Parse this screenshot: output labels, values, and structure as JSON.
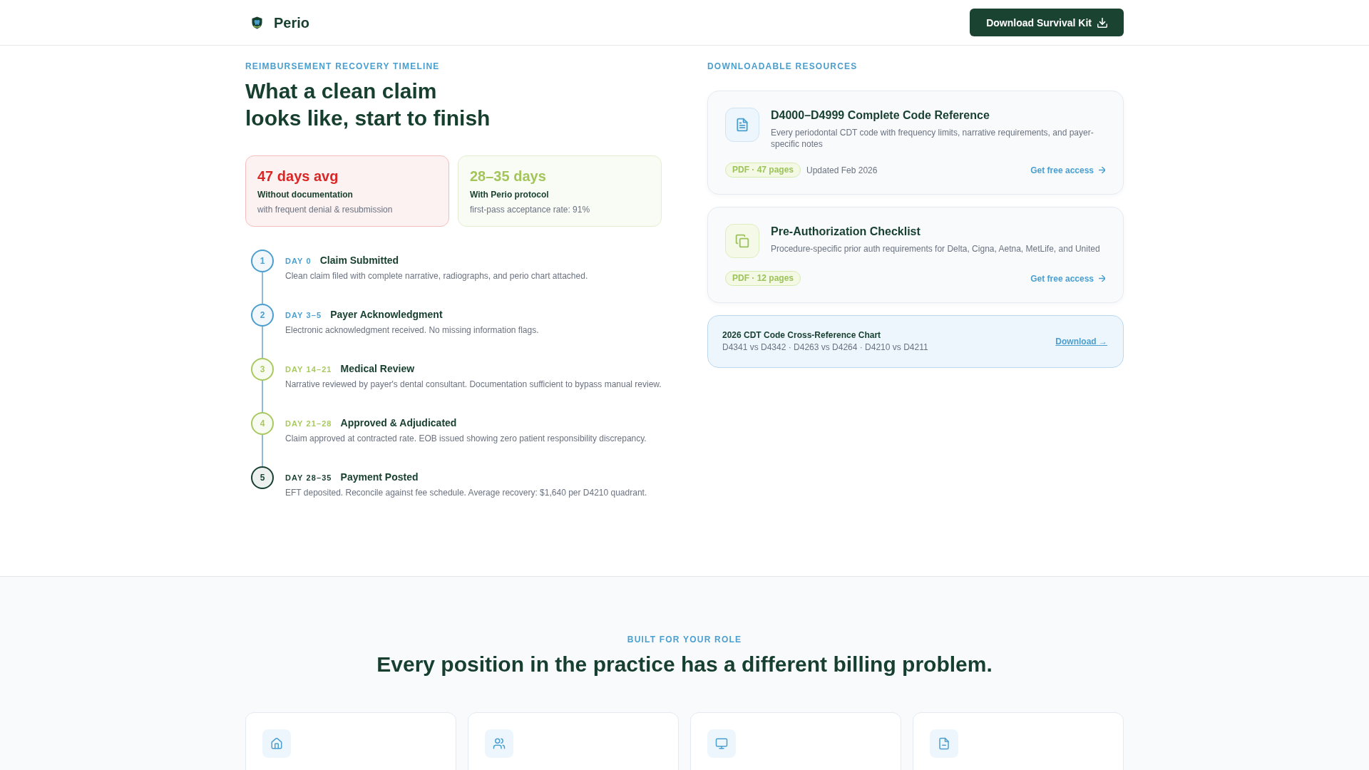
{
  "header": {
    "brand": "Perio",
    "cta": "Download Survival Kit"
  },
  "timeline": {
    "eyebrow": "REIMBURSEMENT RECOVERY TIMELINE",
    "title": "What a clean claim\nlooks like, start to finish",
    "stats": [
      {
        "value": "47 days avg",
        "label": "Without documentation",
        "note": "with frequent denial & resubmission",
        "color": "#dc2626"
      },
      {
        "value": "28–35 days",
        "label": "With Perio protocol",
        "note": "first-pass acceptance rate: 91%",
        "color": "#a3c55a"
      }
    ],
    "steps": [
      {
        "number": "1",
        "day": "DAY 0",
        "title": "Claim Submitted",
        "description": "Clean claim filed with complete narrative, radiographs, and perio chart attached.",
        "color": "#4a9fcf"
      },
      {
        "number": "2",
        "day": "DAY 3–5",
        "title": "Payer Acknowledgment",
        "description": "Electronic acknowledgment received. No missing information flags.",
        "color": "#4a9fcf"
      },
      {
        "number": "3",
        "day": "DAY 14–21",
        "title": "Medical Review",
        "description": "Narrative reviewed by payer's dental consultant. Documentation sufficient to bypass manual review.",
        "color": "#a9c95f"
      },
      {
        "number": "4",
        "day": "DAY 21–28",
        "title": "Approved & Adjudicated",
        "description": "Claim approved at contracted rate. EOB issued showing zero patient responsibility discrepancy.",
        "color": "#a9c95f"
      },
      {
        "number": "5",
        "day": "DAY 28–35",
        "title": "Payment Posted",
        "description": "EFT deposited. Reconcile against fee schedule. Average recovery: $1,640 per D4210 quadrant.",
        "color": "#173f2f"
      }
    ]
  },
  "resources": {
    "eyebrow": "DOWNLOADABLE RESOURCES",
    "items": [
      {
        "title": "D4000–D4999 Complete Code Reference",
        "description": "Every periodontal CDT code with frequency limits, narrative requirements, and payer-specific notes",
        "badge": "PDF · 47 pages",
        "updated": "Updated Feb 2026",
        "link": "Get free access"
      },
      {
        "title": "Pre-Authorization Checklist",
        "description": "Procedure-specific prior auth requirements for Delta, Cigna, Aetna, MetLife, and United",
        "badge": "PDF · 12 pages",
        "link": "Get free access"
      }
    ],
    "banner": {
      "title": "2026 CDT Code Cross-Reference Chart",
      "subtitle": "D4341 vs D4342 · D4263 vs D4264 · D4210 vs D4211",
      "link": "Download →"
    }
  },
  "roles": {
    "eyebrow": "BUILT FOR YOUR ROLE",
    "title": "Every position in the practice has a different billing problem."
  }
}
